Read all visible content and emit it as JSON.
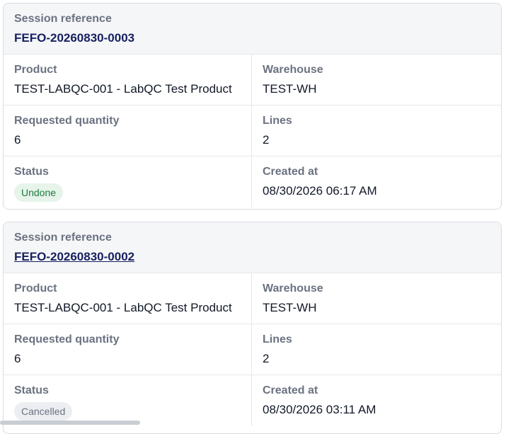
{
  "sessions": [
    {
      "ref_label": "Session reference",
      "reference": "FEFO-20260830-0003",
      "product_label": "Product",
      "product": "TEST-LABQC-001 - LabQC Test Product",
      "warehouse_label": "Warehouse",
      "warehouse": "TEST-WH",
      "qty_label": "Requested quantity",
      "qty": "6",
      "lines_label": "Lines",
      "lines": "2",
      "status_label": "Status",
      "status": "Undone",
      "created_label": "Created at",
      "created": "08/30/2026 06:17 AM"
    },
    {
      "ref_label": "Session reference",
      "reference": "FEFO-20260830-0002",
      "product_label": "Product",
      "product": "TEST-LABQC-001 - LabQC Test Product",
      "warehouse_label": "Warehouse",
      "warehouse": "TEST-WH",
      "qty_label": "Requested quantity",
      "qty": "6",
      "lines_label": "Lines",
      "lines": "2",
      "status_label": "Status",
      "status": "Cancelled",
      "created_label": "Created at",
      "created": "08/30/2026 03:11 AM"
    }
  ],
  "colors": {
    "reference": "#16205f",
    "undone_badge_bg": "#e6f4ea",
    "undone_badge_text": "#1e7a3e",
    "cancelled_badge_bg": "#eceef1",
    "cancelled_badge_text": "#6b7280"
  }
}
